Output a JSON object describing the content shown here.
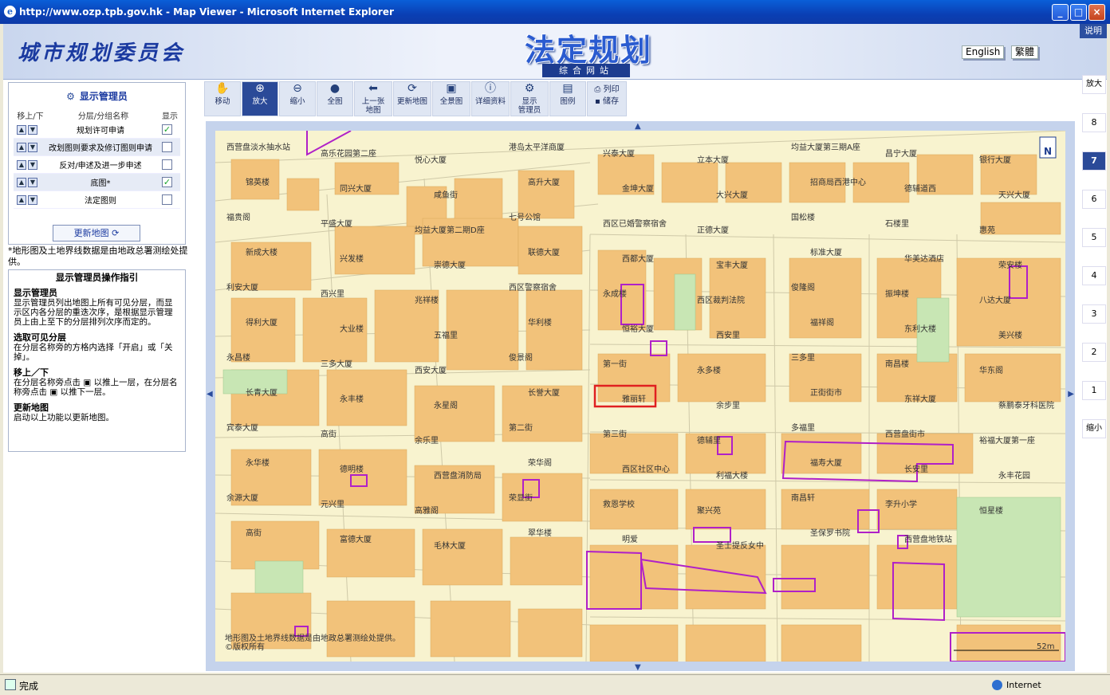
{
  "window": {
    "title": "http://www.ozp.tpb.gov.hk - Map Viewer - Microsoft Internet Explorer"
  },
  "header": {
    "org_name": "城市规划委员会",
    "logo": "法定规划",
    "sublogo": "综合网站",
    "help": "说明",
    "lang_en": "English",
    "lang_tc": "繁體"
  },
  "manager": {
    "title": "显示管理员",
    "col_move": "移上/下",
    "col_name": "分层/分组名称",
    "col_show": "显示",
    "layers": [
      {
        "name": "规划许可申请",
        "checked": true
      },
      {
        "name": "改划图则要求及修订图则申请",
        "checked": false
      },
      {
        "name": "反对/申述及进一步申述",
        "checked": false
      },
      {
        "name": "底图*",
        "checked": true
      },
      {
        "name": "法定图则",
        "checked": false
      }
    ],
    "refresh": "更新地图"
  },
  "note": "*地形图及土地界线数据是由地政总署测绘处提供。",
  "guide": {
    "title": "显示管理员操作指引",
    "s1_h": "显示管理员",
    "s1_t": "显示管理员列出地图上所有可见分层，而显示区内各分层的重迭次序，是根据显示管理员上由上至下的分层排列次序而定的。",
    "s2_h": "选取可见分层",
    "s2_t": "在分层名称旁的方格内选择「开启」或「关掉」。",
    "s3_h": "移上／下",
    "s3_t1": "在分层名称旁点击 ▣ 以推上一层，在分层名称旁点击 ▣ 以推下一层。",
    "s4_h": "更新地图",
    "s4_t": "启动以上功能以更新地图。"
  },
  "toolbar": {
    "pan": "移动",
    "zoom_in": "放大",
    "zoom_out": "缩小",
    "full": "全图",
    "prev1": "上一张",
    "prev2": "地图",
    "refresh": "更新地图",
    "overview": "全景图",
    "detail": "详细资料",
    "mgr1": "显示",
    "mgr2": "管理员",
    "legend": "图例",
    "print": "列印",
    "save": "储存"
  },
  "scale": {
    "zoom_in": "放大",
    "levels": [
      "8",
      "7",
      "6",
      "5",
      "4",
      "3",
      "2",
      "1"
    ],
    "selected": "7",
    "zoom_out": "缩小"
  },
  "map": {
    "copyright1": "地形图及土地界线数据是由地政总署测绘处提供。",
    "copyright2": "©版权所有",
    "scale_bar": "52m",
    "labels": [
      "西营盘淡水抽水站",
      "高乐花园第二座",
      "悦心大厦",
      "港岛太平洋商厦",
      "兴泰大厦",
      "立本大厦",
      "均益大厦第三期A座",
      "昌宁大厦",
      "银行大厦",
      "锦英楼",
      "同兴大厦",
      "咸鱼街",
      "高升大厦",
      "金坤大厦",
      "大兴大厦",
      "招商局西港中心",
      "德辅道西",
      "天兴大厦",
      "福贵阁",
      "平盛大厦",
      "均益大厦第二期D座",
      "七号公馆",
      "西区已婚警察宿舍",
      "正德大厦",
      "国松楼",
      "石楼里",
      "惠苑",
      "新成大楼",
      "兴发楼",
      "崇德大厦",
      "联德大厦",
      "西都大厦",
      "宝丰大厦",
      "标准大厦",
      "华美达酒店",
      "荣安楼",
      "利安大厦",
      "西兴里",
      "兆祥楼",
      "西区警察宿舍",
      "永成楼",
      "西区裁判法院",
      "俊隆阁",
      "振坤楼",
      "八达大厦",
      "得利大厦",
      "大业楼",
      "五福里",
      "华利楼",
      "恒裕大厦",
      "西安里",
      "福祥阁",
      "东利大楼",
      "美兴楼",
      "永昌楼",
      "三多大厦",
      "西安大厦",
      "俊景阁",
      "第一街",
      "永多楼",
      "三多里",
      "南昌楼",
      "华东阁",
      "长青大厦",
      "永丰楼",
      "永星阁",
      "长誉大厦",
      "雅丽轩",
      "余步里",
      "正街街市",
      "东祥大厦",
      "蔡鹏泰牙科医院",
      "宾泰大厦",
      "高街",
      "余乐里",
      "第二街",
      "第三街",
      "德辅里",
      "多福里",
      "西营盘街市",
      "裕福大厦第一座",
      "永华楼",
      "德明楼",
      "西营盘消防局",
      "荣华阁",
      "西区社区中心",
      "利福大楼",
      "福寿大厦",
      "长安里",
      "永丰花园",
      "余源大厦",
      "元兴里",
      "高雅阁",
      "荣显街",
      "救恩学校",
      "聚兴苑",
      "南昌轩",
      "李升小学",
      "恒星楼",
      "高街",
      "富德大厦",
      "毛林大厦",
      "翠华楼",
      "明爱",
      "圣士提反女中",
      "圣保罗书院",
      "西营盘地铁站"
    ]
  }
}
